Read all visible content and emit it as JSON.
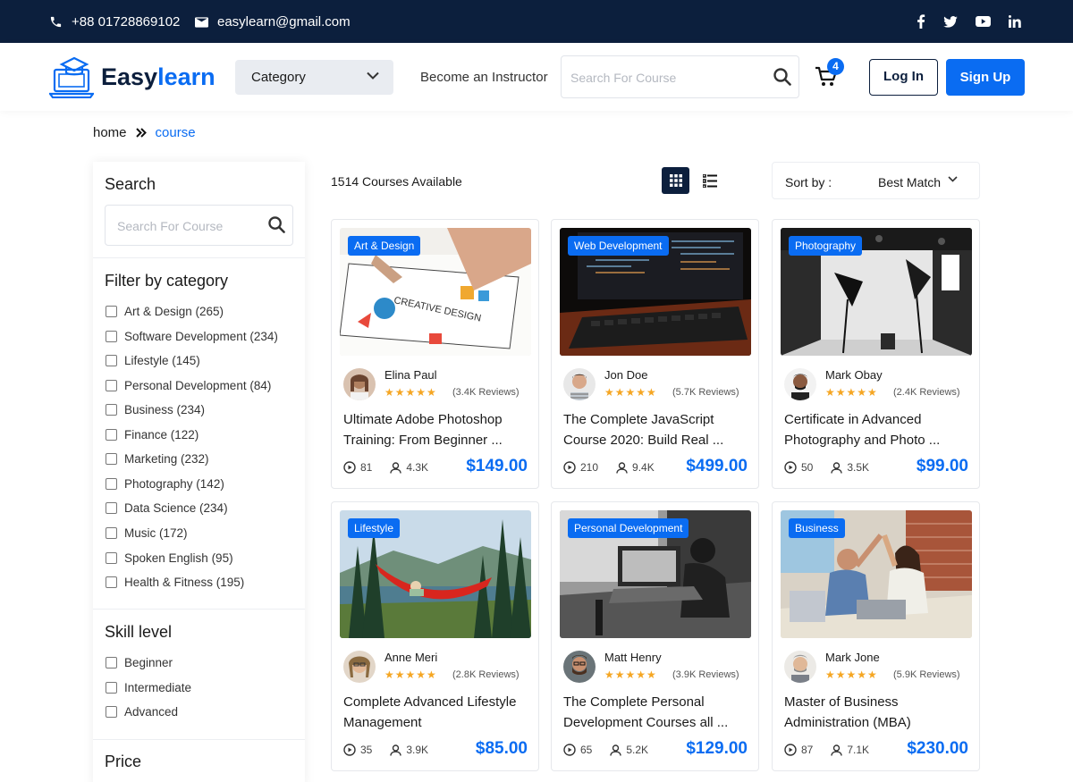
{
  "topbar": {
    "phone": "+88 01728869102",
    "email": "easylearn@gmail.com",
    "social": [
      "facebook-icon",
      "twitter-icon",
      "youtube-icon",
      "linkedin-icon"
    ]
  },
  "header": {
    "logo_part1": "Easy",
    "logo_part2": "learn",
    "category_label": "Category",
    "instructor_link": "Become an Instructor",
    "search_placeholder": "Search For Course",
    "cart_count": "4",
    "login_label": "Log In",
    "signup_label": "Sign Up"
  },
  "breadcrumb": {
    "home": "home",
    "current": "course"
  },
  "sidebar": {
    "search_title": "Search",
    "search_placeholder": "Search For Course",
    "category_title": "Filter by category",
    "categories": [
      "Art & Design (265)",
      "Software Development (234)",
      "Lifestyle (145)",
      "Personal Development (84)",
      "Business (234)",
      "Finance (122)",
      "Marketing (232)",
      "Photography (142)",
      "Data Science (234)",
      "Music (172)",
      "Spoken English (95)",
      "Health & Fitness (195)"
    ],
    "skill_title": "Skill level",
    "skills": [
      "Beginner",
      "Intermediate",
      "Advanced"
    ],
    "price_title": "Price"
  },
  "toolbar": {
    "count_text": "1514 Courses Available",
    "sort_label": "Sort by :",
    "sort_value": "Best Match"
  },
  "courses": [
    {
      "tag": "Art & Design",
      "author": "Elina Paul",
      "stars": "★★★★★",
      "reviews": "(3.4K Reviews)",
      "title1": "Ultimate Adobe Photoshop",
      "title2": "Training: From Beginner ...",
      "lessons": "81",
      "students": "4.3K",
      "price": "$149.00"
    },
    {
      "tag": "Web Development",
      "author": "Jon Doe",
      "stars": "★★★★★",
      "reviews": "(5.7K Reviews)",
      "title1": "The Complete JavaScript",
      "title2": "Course 2020: Build Real ...",
      "lessons": "210",
      "students": "9.4K",
      "price": "$499.00"
    },
    {
      "tag": "Photography",
      "author": "Mark Obay",
      "stars": "★★★★★",
      "reviews": "(2.4K Reviews)",
      "title1": "Certificate in Advanced",
      "title2": "Photography and Photo ...",
      "lessons": "50",
      "students": "3.5K",
      "price": "$99.00"
    },
    {
      "tag": "Lifestyle",
      "author": "Anne Meri",
      "stars": "★★★★★",
      "reviews": "(2.8K Reviews)",
      "title1": "Complete Advanced Lifestyle",
      "title2": "Management",
      "lessons": "35",
      "students": "3.9K",
      "price": "$85.00"
    },
    {
      "tag": "Personal Development",
      "author": "Matt Henry",
      "stars": "★★★★★",
      "reviews": "(3.9K Reviews)",
      "title1": "The Complete Personal",
      "title2": "Development Courses all ...",
      "lessons": "65",
      "students": "5.2K",
      "price": "$129.00"
    },
    {
      "tag": "Business",
      "author": "Mark Jone",
      "stars": "★★★★★",
      "reviews": "(5.9K Reviews)",
      "title1": "Master of Business",
      "title2": "Administration (MBA)",
      "lessons": "87",
      "students": "7.1K",
      "price": "$230.00"
    }
  ],
  "colors": {
    "navy": "#0c1f3d",
    "accent": "#0a6cf2",
    "star": "#f5a623"
  }
}
